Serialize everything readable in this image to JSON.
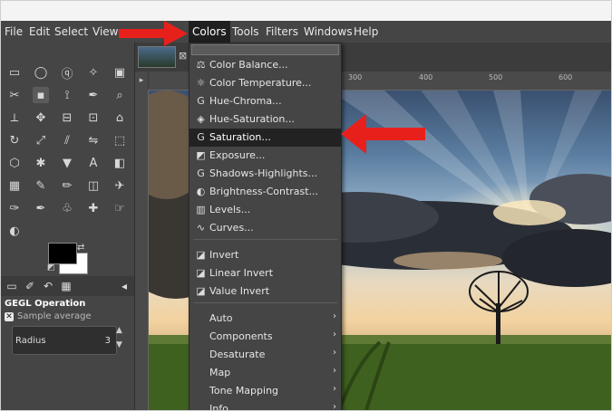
{
  "menubar": {
    "items": [
      {
        "label": "File"
      },
      {
        "label": "Edit"
      },
      {
        "label": "Select"
      },
      {
        "label": "View"
      },
      {
        "label": "Colors"
      },
      {
        "label": "Tools"
      },
      {
        "label": "Filters"
      },
      {
        "label": "Windows"
      },
      {
        "label": "Help"
      }
    ],
    "active": "Colors"
  },
  "toolbox": {
    "tool_icons": [
      "rect-select-icon",
      "ellipse-select-icon",
      "lasso-icon",
      "fuzzy-select-icon",
      "by-color-select-icon",
      "scissors-icon",
      "foreground-select-icon",
      "paths-icon",
      "color-picker-icon",
      "zoom-icon",
      "measure-icon",
      "move-icon",
      "align-icon",
      "crop-icon",
      "unified-transform-icon",
      "rotate-icon",
      "scale-icon",
      "shear-icon",
      "flip-icon",
      "perspective-icon",
      "cage-icon",
      "warp-icon",
      "bucket-fill-icon",
      "text-icon",
      "gradient-icon",
      "pattern-icon",
      "pencil-icon",
      "paintbrush-icon",
      "eraser-icon",
      "airbrush-icon",
      "ink-icon",
      "mypaint-icon",
      "clone-icon",
      "heal-icon",
      "smudge-icon",
      "dodge-burn-icon"
    ],
    "colors": {
      "foreground": "#000000",
      "background": "#ffffff"
    }
  },
  "tool_options": {
    "title": "GEGL Operation",
    "sample_label": "Sample average",
    "radius_label": "Radius",
    "radius_value": "3"
  },
  "colors_menu": {
    "items": [
      {
        "label": "Color Balance...",
        "icon": "color-balance-icon"
      },
      {
        "label": "Color Temperature...",
        "icon": "color-temperature-icon"
      },
      {
        "label": "Hue-Chroma...",
        "icon": "gegl-icon"
      },
      {
        "label": "Hue-Saturation...",
        "icon": "hue-saturation-icon"
      },
      {
        "label": "Saturation...",
        "icon": "gegl-icon",
        "highlighted": true
      },
      {
        "label": "Exposure...",
        "icon": "exposure-icon"
      },
      {
        "label": "Shadows-Highlights...",
        "icon": "gegl-icon"
      },
      {
        "label": "Brightness-Contrast...",
        "icon": "brightness-contrast-icon"
      },
      {
        "label": "Levels...",
        "icon": "levels-icon"
      },
      {
        "label": "Curves...",
        "icon": "curves-icon"
      },
      {
        "label": "Invert",
        "icon": "invert-icon"
      },
      {
        "label": "Linear Invert",
        "icon": "invert-icon"
      },
      {
        "label": "Value Invert",
        "icon": "invert-icon"
      },
      {
        "label": "Auto",
        "submenu": true
      },
      {
        "label": "Components",
        "submenu": true
      },
      {
        "label": "Desaturate",
        "submenu": true
      },
      {
        "label": "Map",
        "submenu": true
      },
      {
        "label": "Tone Mapping",
        "submenu": true
      },
      {
        "label": "Info",
        "submenu": true
      }
    ]
  },
  "ruler": {
    "marks": [
      "300",
      "400",
      "500",
      "600"
    ]
  },
  "annotations": {
    "arrow_color": "#e8201c"
  }
}
